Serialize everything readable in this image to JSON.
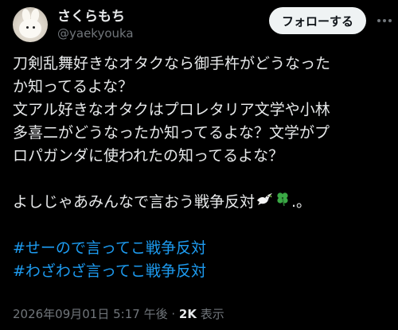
{
  "user": {
    "display_name": "さくらもち",
    "handle": "@yaekyouka",
    "follow_label": "フォローする"
  },
  "post": {
    "lines": [
      "刀剣乱舞好きなオタクなら御手杵がどうなった",
      "か知ってるよな？",
      "文アル好きなオタクはプロレタリア文学や小林",
      "多喜二がどうなったか知ってるよな？文学がプ",
      "ロパガンダに使われたの知ってるよな？"
    ],
    "closing_text": "よしじゃあみんなで言おう戦争反対",
    "closing_suffix": ".。",
    "emoji_icons": [
      "dove-icon",
      "four-leaf-clover-icon"
    ],
    "hashtags": [
      "#せーので言ってこ戦争反対",
      "#わざわざ言ってこ戦争反対"
    ]
  },
  "meta": {
    "timestamp": "2026年09月01日 5:17 午後",
    "separator": "·",
    "views_count": "2K",
    "views_label": "表示"
  },
  "colors": {
    "background": "#000000",
    "text": "#e7e9ea",
    "secondary": "#71767b",
    "link": "#1d9bf0",
    "button_bg": "#eff3f4"
  }
}
